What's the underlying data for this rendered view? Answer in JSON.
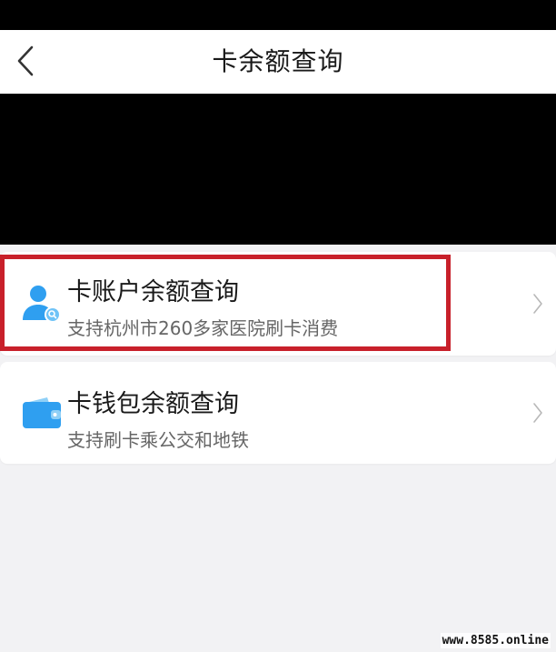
{
  "nav": {
    "title": "卡余额查询",
    "back_icon": "chevron-left-icon"
  },
  "items": [
    {
      "title": "卡账户余额查询",
      "subtitle": "支持杭州市260多家医院刷卡消费",
      "icon": "user-search-icon",
      "highlighted": true
    },
    {
      "title": "卡钱包余额查询",
      "subtitle": "支持刷卡乘公交和地铁",
      "icon": "wallet-icon",
      "highlighted": false
    }
  ],
  "watermark": "www.8585.online",
  "colors": {
    "icon_blue": "#2f9ff0",
    "highlight_red": "#c8202a",
    "background": "#f2f2f4"
  }
}
